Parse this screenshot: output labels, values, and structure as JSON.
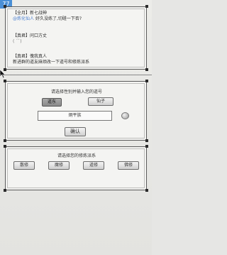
{
  "badge": "77",
  "chat": {
    "messages": [
      {
        "sender": "【全月】新七战神",
        "line2_accent": "@炼化仙人",
        "line2_text": "好久没练了,切磋一下否?"
      },
      {
        "sender": "【真君】问口方丈",
        "line2_accent": "",
        "line2_text": "( ´`)"
      },
      {
        "sender": "【真君】傀我真人",
        "line2_accent": "",
        "line2_text": "新进群的道友麻烦改一下道号和修炼派系"
      }
    ]
  },
  "path_panel": {
    "title": "请选择性别并输入您的道号",
    "gender": {
      "male": "道东",
      "female": "仙子"
    },
    "name_value": "炯平族",
    "confirm": "确认"
  },
  "sect_panel": {
    "title": "请选择您的修炼派系",
    "options": [
      "散修",
      "魔修",
      "道修",
      "佛修"
    ]
  }
}
